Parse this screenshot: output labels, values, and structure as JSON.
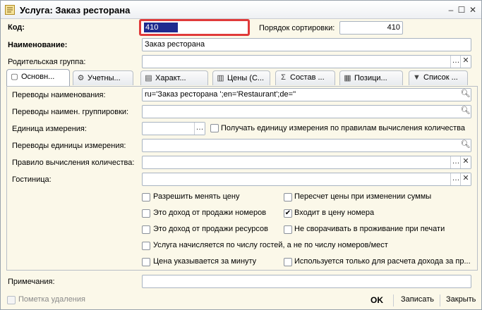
{
  "window": {
    "title": "Услуга: Заказ ресторана",
    "controls": {
      "minimize": "–",
      "maximize": "☐",
      "close": "✕"
    }
  },
  "header": {
    "code_label": "Код:",
    "code_value": "410",
    "sort_label": "Порядок сортировки:",
    "sort_value": "410",
    "name_label": "Наименование:",
    "name_value": "Заказ ресторана",
    "parent_label": "Родительская группа:",
    "parent_value": ""
  },
  "tabs": [
    {
      "label": "Основн...",
      "icon": "doc-icon",
      "active": true
    },
    {
      "label": "Учетны...",
      "icon": "gear-icon"
    },
    {
      "label": "Характ...",
      "icon": "doc-lines-icon"
    },
    {
      "label": "Цены (С...",
      "icon": "price-icon"
    },
    {
      "label": "Состав ...",
      "icon": "sigma-icon"
    },
    {
      "label": "Позици...",
      "icon": "table-icon"
    },
    {
      "label": "Список ...",
      "icon": "triangle-down-icon"
    }
  ],
  "main": {
    "name_translations_label": "Переводы наименования:",
    "name_translations_value": "ru='Заказ ресторана ';en='Restaurant';de=''",
    "group_translations_label": "Переводы наимен. группировки:",
    "group_translations_value": "",
    "unit_label": "Единица измерения:",
    "unit_value": "",
    "unit_checkbox_label": "Получать единицу измерения по правилам вычисления количества",
    "unit_translations_label": "Переводы единицы измерения:",
    "unit_translations_value": "",
    "qty_rule_label": "Правило вычисления количества:",
    "qty_rule_value": "",
    "hotel_label": "Гостиница:",
    "hotel_value": ""
  },
  "checkboxes": {
    "allow_price_change": {
      "label": "Разрешить менять цену",
      "checked": false
    },
    "recalc_price": {
      "label": "Пересчет цены при изменении суммы",
      "checked": false
    },
    "room_income": {
      "label": "Это доход от продажи номеров",
      "checked": false
    },
    "in_room_price": {
      "label": "Входит в цену номера",
      "checked": true
    },
    "resource_income": {
      "label": "Это доход от продажи ресурсов",
      "checked": false
    },
    "no_collapse": {
      "label": "Не сворачивать в проживание при печати",
      "checked": false
    },
    "by_guests": {
      "label": "Услуга начисляется по числу гостей, а не по числу номеров/мест",
      "checked": false
    },
    "per_minute": {
      "label": "Цена указывается за минуту",
      "checked": false
    },
    "revenue_only": {
      "label": "Используется только для расчета дохода за пр...",
      "checked": false
    }
  },
  "notes": {
    "label": "Примечания:",
    "value": ""
  },
  "footer": {
    "delete_mark_label": "Пометка удаления",
    "ok_label": "OK",
    "save_label": "Записать",
    "close_label": "Закрыть"
  }
}
